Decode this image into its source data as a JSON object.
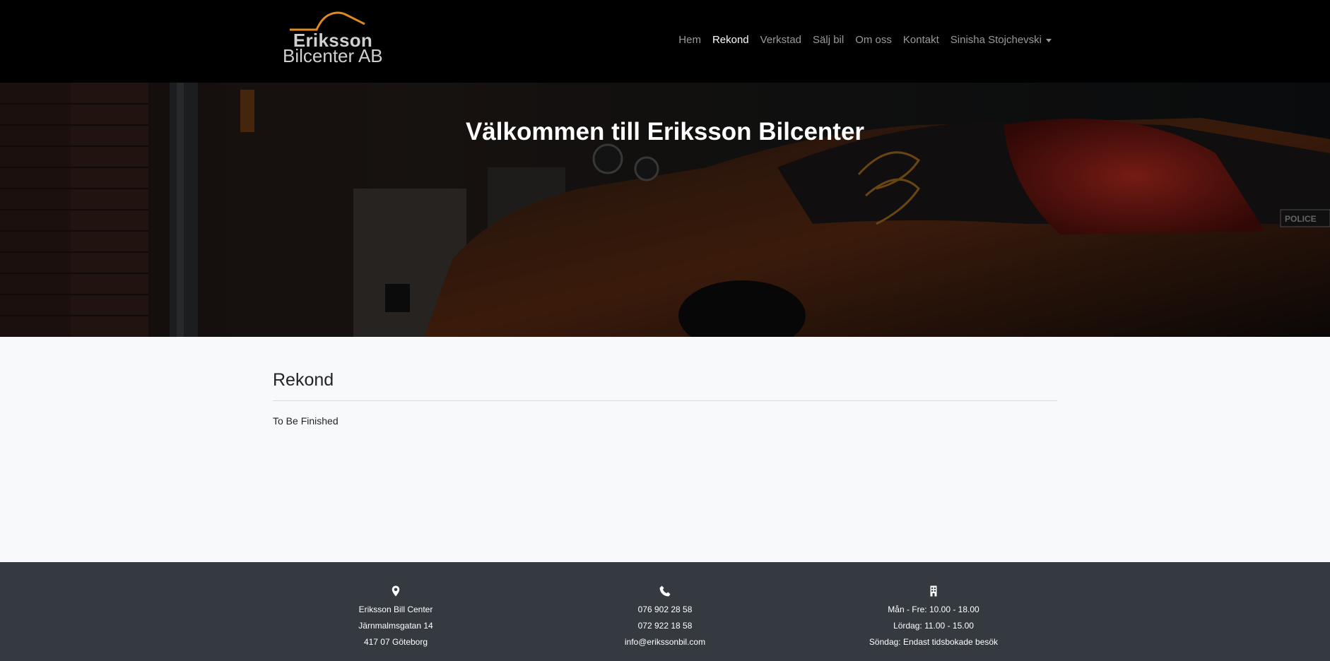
{
  "brand": {
    "name_line1": "Eriksson",
    "name_line2": "Bilcenter AB",
    "accent_color": "#e08a1e"
  },
  "nav": {
    "items": [
      {
        "label": "Hem",
        "active": false
      },
      {
        "label": "Rekond",
        "active": true
      },
      {
        "label": "Verkstad",
        "active": false
      },
      {
        "label": "Sälj bil",
        "active": false
      },
      {
        "label": "Om oss",
        "active": false
      },
      {
        "label": "Kontakt",
        "active": false
      }
    ],
    "user_menu": "Sinisha Stojchevski"
  },
  "hero": {
    "title": "Välkommen till Eriksson Bilcenter",
    "badge_text": "POLICE"
  },
  "main": {
    "heading": "Rekond",
    "text": "To Be Finished"
  },
  "footer": {
    "address": {
      "icon": "map-pin-icon",
      "lines": [
        "Eriksson Bill Center",
        "Järnmalmsgatan 14",
        "417 07 Göteborg"
      ]
    },
    "contact": {
      "icon": "phone-icon",
      "lines": [
        "076 902 28 58",
        "072 922 18 58",
        "info@erikssonbil.com"
      ]
    },
    "hours": {
      "icon": "building-icon",
      "lines": [
        "Mån - Fre: 10.00 - 18.00",
        "Lördag: 11.00 - 15.00",
        "Söndag: Endast tidsbokade besök"
      ]
    },
    "bg_color": "#343a40"
  }
}
